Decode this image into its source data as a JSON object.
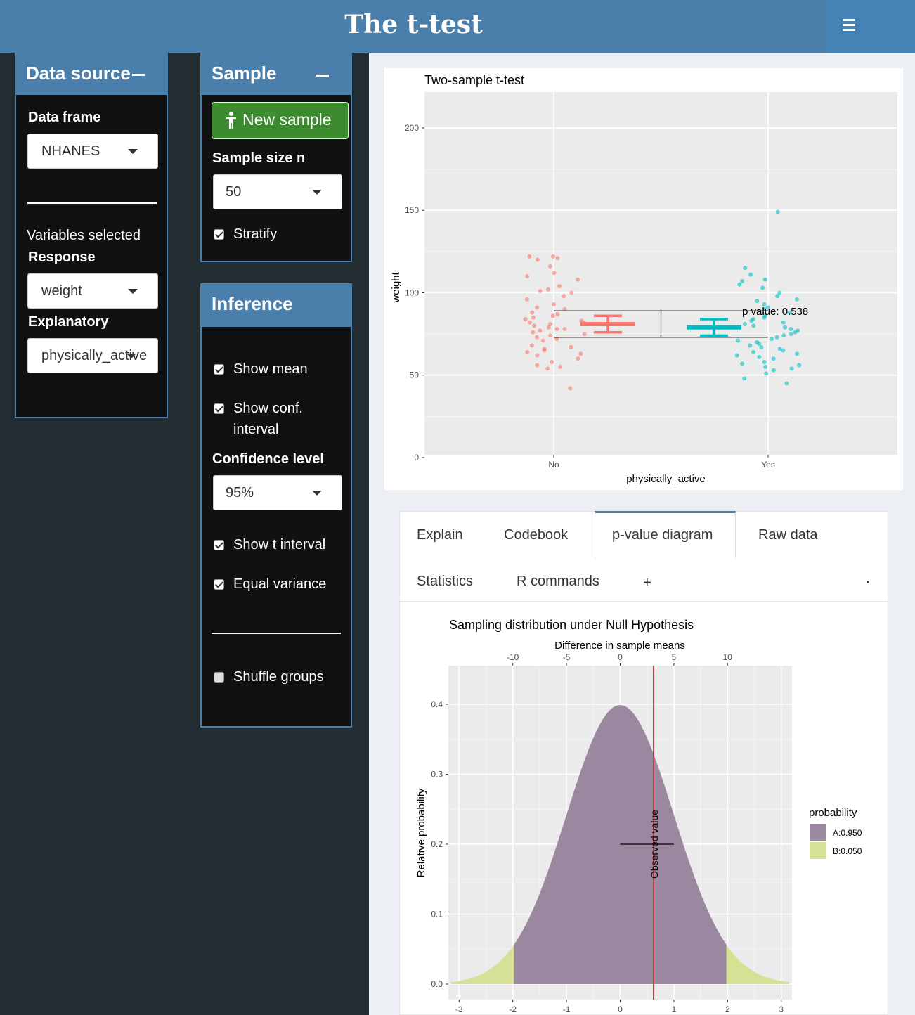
{
  "header": {
    "title": "The t-test"
  },
  "data_source": {
    "title": "Data source",
    "data_frame_label": "Data frame",
    "data_frame_value": "NHANES",
    "variables_selected": "Variables selected",
    "response_label": "Response",
    "response_value": "weight",
    "explanatory_label": "Explanatory",
    "explanatory_value": "physically_active"
  },
  "sample": {
    "title": "Sample",
    "new_sample": "New sample",
    "size_label": "Sample size n",
    "size_value": "50",
    "stratify": "Stratify",
    "stratify_checked": true
  },
  "inference": {
    "title": "Inference",
    "show_mean": "Show mean",
    "show_conf_1": "Show conf.",
    "show_conf_2": "interval",
    "conf_level_label": "Confidence level",
    "conf_level_value": "95%",
    "show_t_interval": "Show t interval",
    "equal_variance": "Equal variance",
    "shuffle_groups": "Shuffle groups"
  },
  "tabs": {
    "explain": "Explain",
    "codebook": "Codebook",
    "pvalue": "p-value diagram",
    "raw": "Raw data",
    "statistics": "Statistics",
    "rcommands": "R commands",
    "plus": "+",
    "active": "p-value diagram"
  },
  "chart_data": [
    {
      "type": "scatter",
      "title": "Two-sample t-test",
      "xlabel": "physically_active",
      "ylabel": "weight",
      "categories": [
        "No",
        "Yes"
      ],
      "ylim": [
        0,
        220
      ],
      "yticks": [
        0,
        50,
        100,
        150,
        200
      ],
      "grid": true,
      "series": [
        {
          "group": "No",
          "color": "#f8766d",
          "mean": 81,
          "ci": [
            76,
            86
          ],
          "values": [
            122,
            121,
            122,
            120,
            116,
            112,
            110,
            108,
            104,
            102,
            101,
            100,
            98,
            96,
            93,
            91,
            90,
            88,
            87,
            86,
            85,
            84,
            83,
            82,
            82,
            81,
            81,
            80,
            79,
            78,
            78,
            77,
            76,
            75,
            74,
            73,
            72,
            71,
            68,
            67,
            66,
            65,
            64,
            63,
            62,
            60,
            58,
            56,
            55,
            54,
            42
          ]
        },
        {
          "group": "Yes",
          "color": "#00bfc4",
          "mean": 79,
          "ci": [
            74,
            84
          ],
          "values": [
            149,
            115,
            111,
            108,
            107,
            105,
            103,
            100,
            98,
            96,
            95,
            93,
            91,
            90,
            88,
            86,
            85,
            84,
            83,
            82,
            81,
            80,
            79,
            78,
            77,
            76,
            75,
            74,
            73,
            72,
            71,
            70,
            69,
            68,
            67,
            66,
            65,
            64,
            63,
            62,
            61,
            60,
            58,
            57,
            56,
            55,
            54,
            53,
            51,
            48,
            45
          ]
        }
      ],
      "annotation": "p value: 0.538",
      "bracket": {
        "y_high": 89,
        "y_low": 73
      }
    },
    {
      "type": "area",
      "title": "Sampling distribution under Null Hypothesis",
      "top_axis_label": "Difference in sample means",
      "top_ticks": [
        -10,
        -5,
        0,
        5,
        10
      ],
      "ylabel": "Relative probability",
      "x_ticks": [
        -3,
        -2,
        -1,
        0,
        1,
        2,
        3
      ],
      "y_ticks": [
        0.0,
        0.1,
        0.2,
        0.3,
        0.4
      ],
      "xlim": [
        -3.2,
        3.2
      ],
      "critical_t": 1.98,
      "observed_t": 0.62,
      "observed_label": "Observed value",
      "legend_title": "probability",
      "legend": [
        {
          "label": "A:0.950",
          "color": "#9c87a0"
        },
        {
          "label": "B:0.050",
          "color": "#d7e195"
        }
      ]
    }
  ]
}
